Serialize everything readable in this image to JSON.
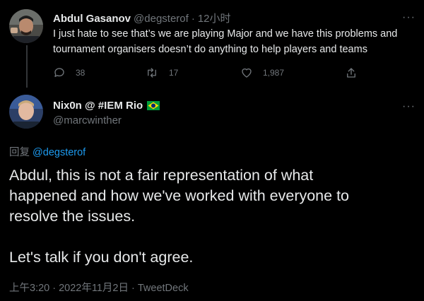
{
  "parent_tweet": {
    "display_name": "Abdul Gasanov",
    "handle": "@degsterof",
    "separator": "·",
    "time": "12小时",
    "text_line1": "I just hate to see that’s we are playing Major and we have this problems and",
    "text_line2": "tournament organisers doesn’t do anything to help players and teams",
    "reply_count": "38",
    "retweet_count": "17",
    "like_count": "1,987"
  },
  "main_tweet": {
    "display_name": "Nix0n @ #IEM Rio",
    "flag": "🇧🇷",
    "handle": "@marcwinther",
    "reply_prefix": "回复",
    "reply_to": "@degsterof",
    "text_line1": "Abdul, this is not a fair representation of what",
    "text_line2": "happened and how we've worked with everyone to",
    "text_line3": "resolve the issues.",
    "text_line4": "Let's talk if you don't agree.",
    "timestamp": "上午3:20 · 2022年11月2日 · TweetDeck"
  },
  "icons": {
    "more": "more-icon",
    "reply": "reply-icon",
    "retweet": "retweet-icon",
    "like": "heart-icon",
    "share": "share-icon",
    "flag": "brazil-flag-icon"
  },
  "colors": {
    "background": "#000000",
    "text": "#e7e9ea",
    "muted": "#71767b",
    "link": "#1d9bf0"
  }
}
